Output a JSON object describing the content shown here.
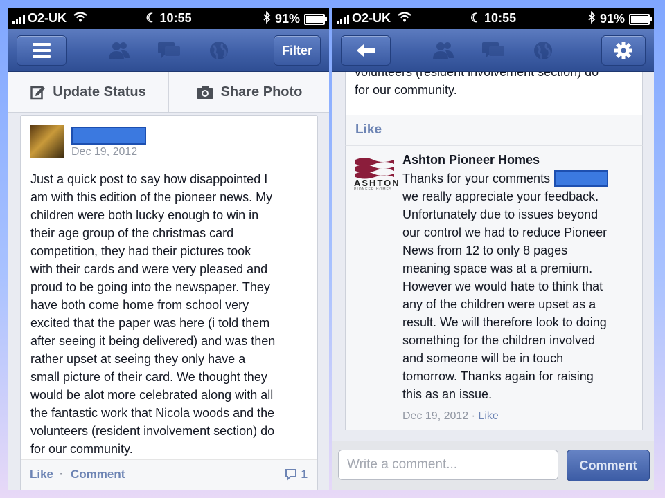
{
  "status_bar": {
    "carrier": "O2-UK",
    "time": "10:55",
    "battery": "91%",
    "battery_level": 0.91
  },
  "left_screen": {
    "nav": {
      "filter_label": "Filter"
    },
    "actions": {
      "update_status": "Update Status",
      "share_photo": "Share Photo"
    },
    "post": {
      "date": "Dec 19, 2012",
      "lines": [
        "Just a quick post to say how disappointed I",
        "am with this edition of the pioneer news. My",
        "children were both lucky enough to win in",
        "their age group of the christmas card",
        "competition, they had their pictures took",
        "with their cards and were very pleased and",
        "proud to be going into the newspaper. They",
        "have both come home from school very",
        "excited that the paper was here (i told them",
        "after seeing it being delivered) and was then",
        "rather upset at seeing they only have a",
        "small picture of their card. We thought they",
        "would be alot more celebrated along with all",
        "the fantastic work that Nicola woods and the",
        "volunteers (resident involvement section) do",
        "for our community."
      ],
      "like_label": "Like",
      "separator": "·",
      "comment_label": "Comment",
      "comment_count": "1"
    }
  },
  "right_screen": {
    "post_tail": {
      "line_cut": "volunteers (resident involvement section) do",
      "line_last": "for our community."
    },
    "like_label": "Like",
    "comment": {
      "author": "Ashton Pioneer Homes",
      "logo_text": "ASHTON",
      "logo_subtext": "PIONEER HOMES",
      "first_line": "Thanks for your comments",
      "lines": [
        "we really appreciate your feedback.",
        "Unfortunately due to issues beyond",
        "our control we had to reduce Pioneer",
        "News from 12 to only 8 pages",
        "meaning space was at a premium.",
        "However we would hate to think that",
        "any of the children were upset as a",
        "result. We will therefore look to doing",
        "something for the children involved",
        "and someone will be in touch",
        "tomorrow. Thanks again for raising",
        "this as an issue."
      ],
      "date": "Dec 19, 2012",
      "separator": "·",
      "like_label": "Like"
    },
    "composer": {
      "placeholder": "Write a comment...",
      "button_label": "Comment"
    }
  },
  "colors": {
    "facebook_blue": "#3b5998",
    "link": "#6d84b4",
    "redaction": "#3b79e0",
    "ashton_maroon": "#8b1d3b"
  }
}
